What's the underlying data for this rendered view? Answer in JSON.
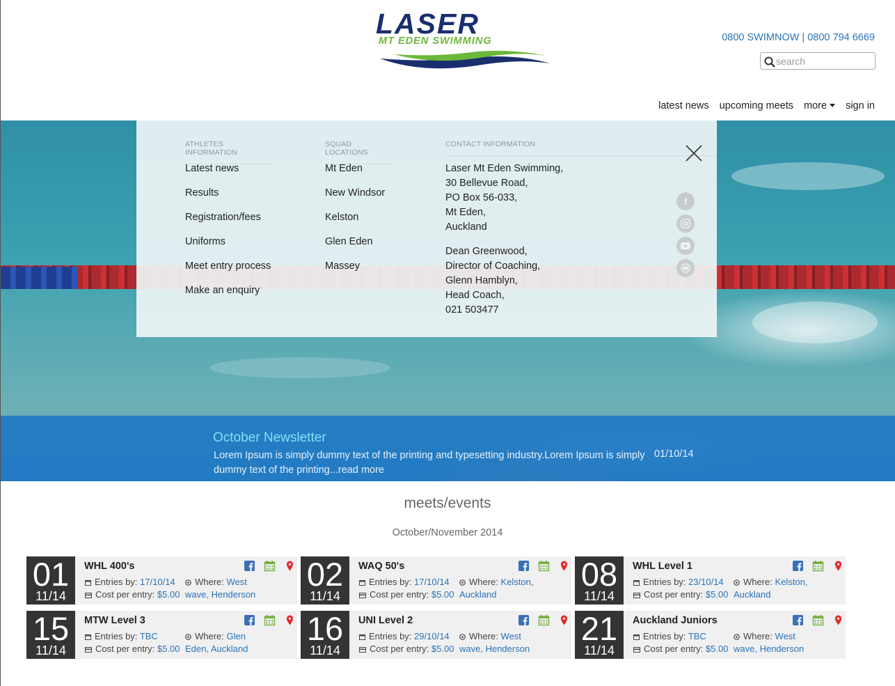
{
  "header": {
    "logo_text": "LASER",
    "logo_sub": "MT EDEN SWIMMING",
    "phone": "0800 SWIMNOW | 0800 794 6669",
    "search_placeholder": "search",
    "nav": [
      "latest news",
      "upcoming meets",
      "more",
      "sign in"
    ]
  },
  "menu": {
    "athletes_head": "ATHLETES INFORMATION",
    "athletes": [
      "Latest news",
      "Results",
      "Registration/fees",
      "Uniforms",
      "Meet entry process",
      "Make an enquiry"
    ],
    "squads_head": "SQUAD LOCATIONS",
    "squads": [
      "Mt Eden",
      "New Windsor",
      "Kelston",
      "Glen Eden",
      "Massey"
    ],
    "contact_head": "CONTACT INFORMATION",
    "contact_address": [
      "Laser Mt Eden Swimming,",
      "30 Bellevue Road,",
      "PO Box 56-033,",
      "Mt Eden,",
      "Auckland"
    ],
    "contact_people": [
      "Dean Greenwood,",
      "Director of Coaching,",
      "Glenn Hamblyn,",
      "Head Coach,",
      "021 503477"
    ],
    "social_icons": [
      "facebook-icon",
      "instagram-icon",
      "youtube-icon",
      "email-icon"
    ]
  },
  "newsletter": {
    "title": "October Newsletter",
    "body": "Lorem Ipsum is simply dummy text of the printing and typesetting industry.Lorem Ipsum is simply dummy text of the printing...read more",
    "date": "01/10/14"
  },
  "meets": {
    "title": "meets/events",
    "subtitle": "October/November 2014",
    "entries_label": "Entries by:",
    "where_label": "Where:",
    "cost_label": "Cost per entry:",
    "cards": [
      {
        "day": "01",
        "month": "11/14",
        "name": "WHL 400's",
        "entries": "17/10/14",
        "where1": "West",
        "where2": "wave, Henderson",
        "cost": "$5.00"
      },
      {
        "day": "02",
        "month": "11/14",
        "name": "WAQ 50's",
        "entries": "17/10/14",
        "where1": "Kelston,",
        "where2": "Auckland",
        "cost": "$5.00"
      },
      {
        "day": "08",
        "month": "11/14",
        "name": "WHL Level 1",
        "entries": "23/10/14",
        "where1": "Kelston,",
        "where2": "Auckland",
        "cost": "$5.00"
      },
      {
        "day": "15",
        "month": "11/14",
        "name": "MTW Level 3",
        "entries": "TBC",
        "where1": "Glen",
        "where2": "Eden, Auckland",
        "cost": "$5.00"
      },
      {
        "day": "16",
        "month": "11/14",
        "name": "UNI Level 2",
        "entries": "29/10/14",
        "where1": "West",
        "where2": "wave, Henderson",
        "cost": "$5.00"
      },
      {
        "day": "21",
        "month": "11/14",
        "name": "Auckland Juniors",
        "entries": "TBC",
        "where1": "West",
        "where2": "wave, Henderson",
        "cost": "$5.00"
      }
    ]
  },
  "colors": {
    "brand_blue": "#1a2e6e",
    "brand_green": "#6bb83a",
    "link_blue": "#2a73b8",
    "newsletter_bg": "#2078c4"
  }
}
